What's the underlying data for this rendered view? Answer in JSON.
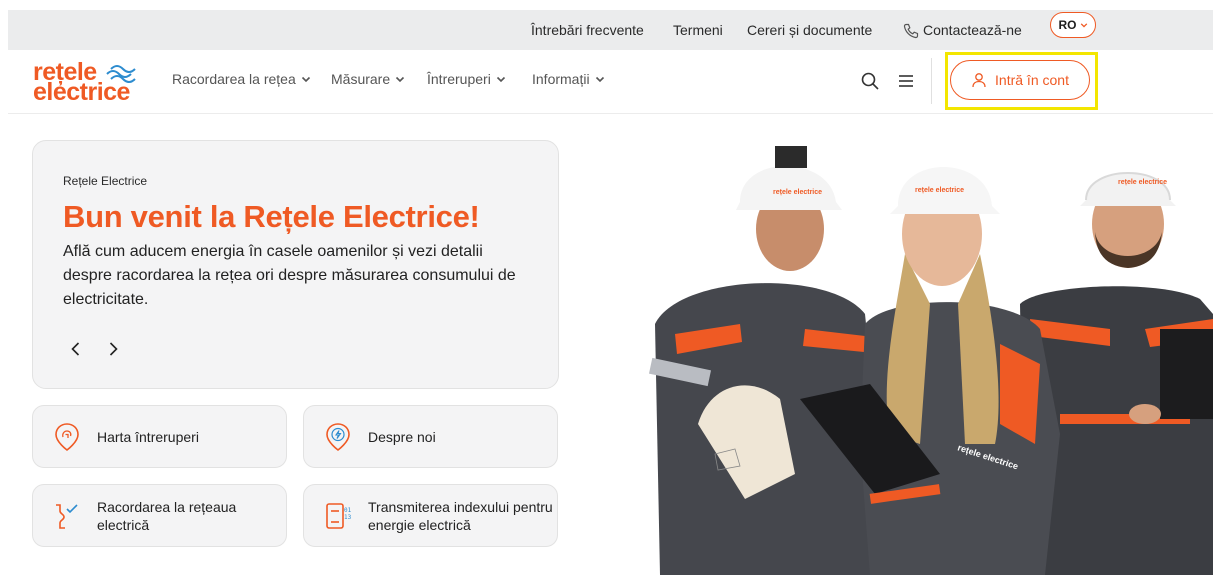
{
  "topbar": {
    "faq": "Întrebări frecvente",
    "terms": "Termeni",
    "requests": "Cereri și documente",
    "contact": "Contactează-ne",
    "lang": "RO"
  },
  "logo": {
    "line1": "rețele",
    "line2": "electrice"
  },
  "nav": {
    "items": [
      {
        "label": "Racordarea la rețea"
      },
      {
        "label": "Măsurare"
      },
      {
        "label": "Întreruperi"
      },
      {
        "label": "Informații"
      }
    ],
    "login": "Intră în cont"
  },
  "hero": {
    "eyebrow": "Rețele Electrice",
    "title": "Bun venit la Rețele Electrice!",
    "description": "Află cum aducem energia în casele oamenilor și vezi detalii despre racordarea la rețea ori despre măsurarea consumului de electricitate."
  },
  "quick_links": [
    {
      "label": "Harta întreruperi",
      "icon": "map-pin-icon"
    },
    {
      "label": "Despre noi",
      "icon": "lightning-pin-icon"
    },
    {
      "label": "Racordarea la rețeaua electrică",
      "icon": "connection-icon"
    },
    {
      "label": "Transmiterea indexului pentru energie electrică",
      "icon": "meter-icon"
    }
  ],
  "photo": {
    "helmet_text": "rețele electrice",
    "jacket_text": "rețele electrice"
  },
  "colors": {
    "brand": "#ef5a24",
    "topbar_bg": "#ebeced",
    "card_bg": "#f4f4f5",
    "highlight": "#f3e600"
  }
}
